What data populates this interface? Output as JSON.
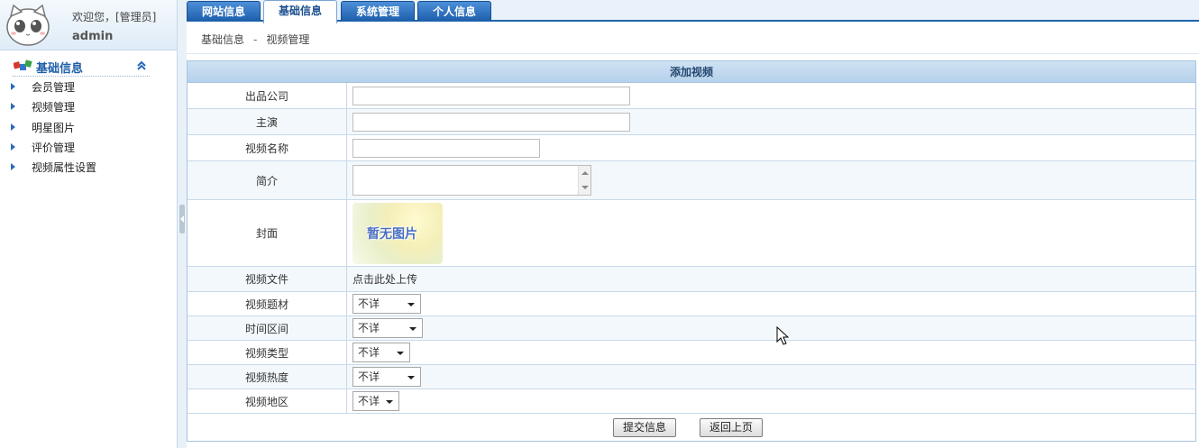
{
  "user": {
    "welcome": "欢迎您，[管理员]",
    "name": "admin",
    "avatar_icon": "cat-avatar-icon"
  },
  "sidebar": {
    "section_title": "基础信息",
    "section_icon": "colored-blocks-icon",
    "collapse_icon": "double-chevron-up-icon",
    "items": [
      {
        "label": "会员管理"
      },
      {
        "label": "视频管理"
      },
      {
        "label": "明星图片"
      },
      {
        "label": "评价管理"
      },
      {
        "label": "视频属性设置"
      }
    ]
  },
  "tabs": [
    {
      "label": "网站信息",
      "active": false
    },
    {
      "label": "基础信息",
      "active": true
    },
    {
      "label": "系统管理",
      "active": false
    },
    {
      "label": "个人信息",
      "active": false
    }
  ],
  "breadcrumb": {
    "root": "基础信息",
    "separator": "-",
    "current": "视频管理"
  },
  "form": {
    "title": "添加视频",
    "fields": {
      "company": {
        "label": "出品公司",
        "value": ""
      },
      "actor": {
        "label": "主演",
        "value": ""
      },
      "video_name": {
        "label": "视频名称",
        "value": ""
      },
      "intro": {
        "label": "简介",
        "value": ""
      },
      "cover": {
        "label": "封面",
        "placeholder_text": "暂无图片"
      },
      "video_file": {
        "label": "视频文件",
        "link": "点击此处上传"
      },
      "theme": {
        "label": "视频题材",
        "selected": "不详"
      },
      "period": {
        "label": "时间区间",
        "selected": "不详"
      },
      "type": {
        "label": "视频类型",
        "selected": "不详"
      },
      "heat": {
        "label": "视频热度",
        "selected": "不详"
      },
      "region": {
        "label": "视频地区",
        "selected": "不详"
      }
    },
    "submit_label": "提交信息",
    "back_label": "返回上页"
  },
  "colors": {
    "accent": "#1f64ad",
    "panel_header": "#b5d1eb",
    "row_border": "#c8d9ea"
  }
}
